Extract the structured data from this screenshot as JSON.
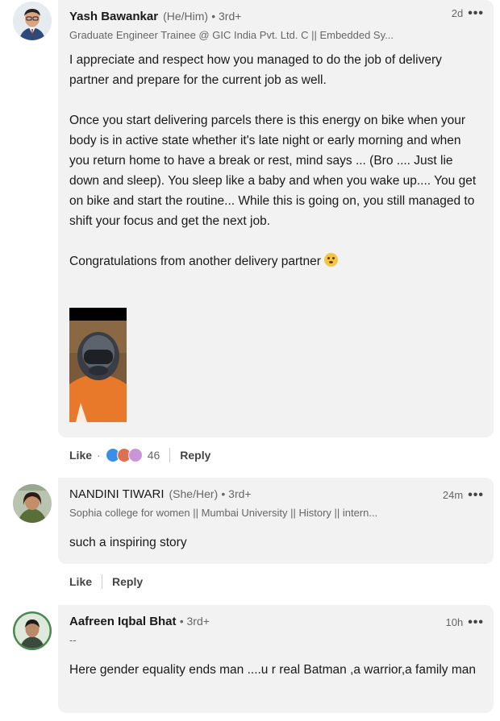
{
  "comments": [
    {
      "name": "Yash Bawankar",
      "pronoun": "(He/Him)",
      "degree": "• 3rd+",
      "headline": "Graduate Engineer Trainee @ GIC India Pvt. Ltd. C || Embedded Sy...",
      "time": "2d",
      "more": "•••",
      "paragraphs": [
        "I appreciate and respect how you managed to do the job of delivery partner and prepare for the current job as well.",
        "Once you start delivering parcels there is this energy on bike when your body is in active state whether it's late night or early morning and when you return home to have a break or rest, mind says ... (Bro .... Just lie down and sleep). You sleep like a baby and when you wake up.... You get on bike and start the routine... While this is going on, you still managed to shift your focus and get the next job.",
        "Congratulations from another delivery partner"
      ],
      "like": "Like",
      "reaction_dot": "·",
      "reaction_count": "46",
      "reply": "Reply"
    },
    {
      "name": "NANDINI TIWARI",
      "pronoun": "(She/Her)",
      "degree": "• 3rd+",
      "headline": "Sophia college for women || Mumbai University || History || intern...",
      "time": "24m",
      "more": "•••",
      "text": "such a inspiring story",
      "like": "Like",
      "reply": "Reply"
    },
    {
      "name": "Aafreen Iqbal Bhat",
      "degree": "• 3rd+",
      "headline": "--",
      "time": "10h",
      "more": "•••",
      "text": "Here gender equality ends man ....u r real Batman ,a warrior,a family man"
    }
  ],
  "colors": {
    "bubble": "#f2f2f2",
    "reaction_like": "#378fe9",
    "reaction_love": "#df704d",
    "reaction_support": "#c896d8"
  }
}
